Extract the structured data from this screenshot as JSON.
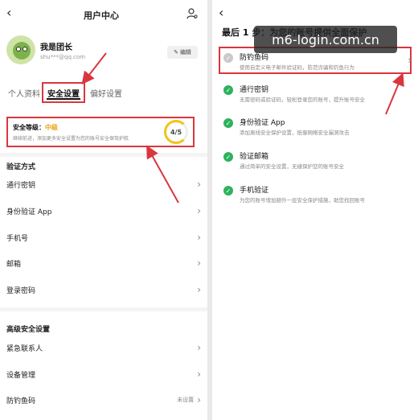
{
  "left": {
    "title": "用户中心",
    "back_icon": "‹",
    "profile": {
      "name": "我是团长",
      "email": "shu***@qq.com",
      "edit_label": "编辑"
    },
    "tabs": [
      {
        "label": "个人资料"
      },
      {
        "label": "安全设置"
      },
      {
        "label": "偏好设置"
      }
    ],
    "security": {
      "label": "安全等级：",
      "level": "中级",
      "desc": "继续前进，添加更多安全设置为您的账号安全保驾护航",
      "score": "4/5"
    },
    "verify_section": "验证方式",
    "verify_items": [
      {
        "label": "通行密钥"
      },
      {
        "label": "身份验证 App"
      },
      {
        "label": "手机号"
      },
      {
        "label": "邮箱"
      },
      {
        "label": "登录密码"
      }
    ],
    "advanced_section": "高级安全设置",
    "advanced_items": [
      {
        "label": "紧急联系人",
        "value": ""
      },
      {
        "label": "设备管理",
        "value": ""
      },
      {
        "label": "防钓鱼码",
        "value": "未设置"
      }
    ]
  },
  "right": {
    "back_icon": "‹",
    "step_title": "最后 1 步：为您的账号提供全面保护",
    "watermark": "m6-login.com.cn",
    "options": [
      {
        "title": "防钓鱼码",
        "desc": "使用自定义电子邮件验证码，防范诈骗和钓鱼行为"
      },
      {
        "title": "通行密钥",
        "desc": "无需密码或验证码，轻松登录您的账号，提升账号安全"
      },
      {
        "title": "身份验证 App",
        "desc": "添加离线安全保护设置，抵御网络安全漏洞攻击"
      },
      {
        "title": "验证邮箱",
        "desc": "通过简单的安全设置，无缝保护您的账号安全"
      },
      {
        "title": "手机验证",
        "desc": "为您的账号增加额外一层安全保护措施，助您找回账号"
      }
    ]
  },
  "colors": {
    "accent_red": "#d9363e",
    "success_green": "#2db35d",
    "warning_yellow": "#f0c419"
  }
}
